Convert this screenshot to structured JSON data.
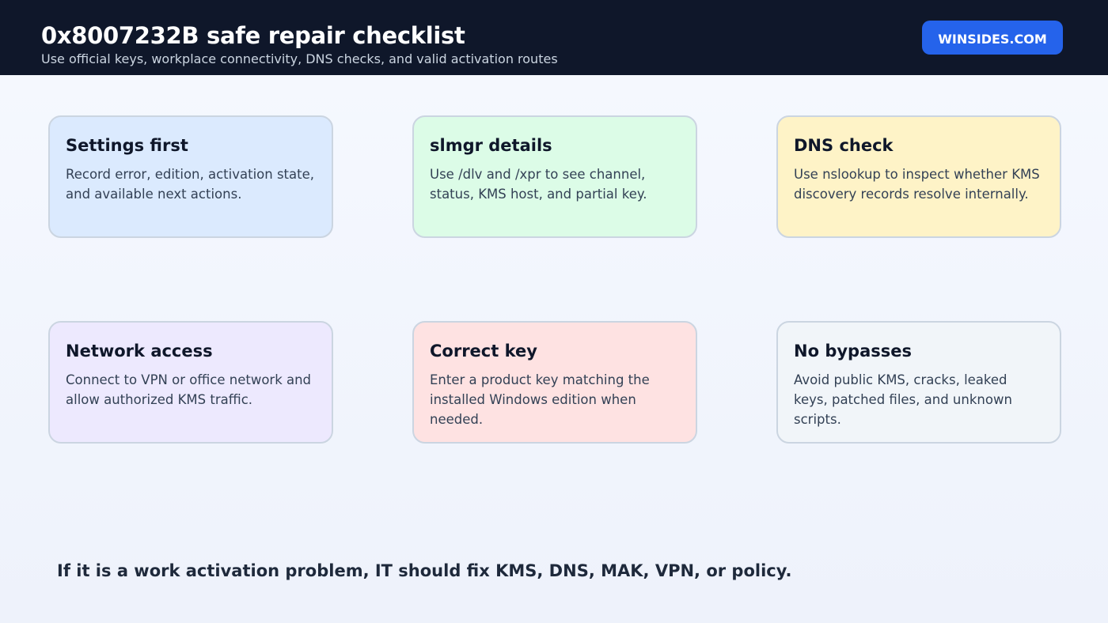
{
  "header": {
    "title": "0x8007232B safe repair checklist",
    "subtitle": "Use official keys, workplace connectivity, DNS checks, and valid activation routes",
    "brand": "WINSIDES.COM"
  },
  "cards": [
    {
      "title": "Settings first",
      "text": "Record error, edition, activation state, and available next actions.",
      "color": "#dbeafe"
    },
    {
      "title": "slmgr details",
      "text": "Use /dlv and /xpr to see channel, status, KMS host, and partial key.",
      "color": "#dcfce7"
    },
    {
      "title": "DNS check",
      "text": "Use nslookup to inspect whether KMS discovery records resolve internally.",
      "color": "#fef3c7"
    },
    {
      "title": "Network access",
      "text": "Connect to VPN or office network and allow authorized KMS traffic.",
      "color": "#ede9fe"
    },
    {
      "title": "Correct key",
      "text": "Enter a product key matching the installed Windows edition when needed.",
      "color": "#fee2e2"
    },
    {
      "title": "No bypasses",
      "text": "Avoid public KMS, cracks, leaked keys, patched files, and unknown scripts.",
      "color": "#f1f5f9"
    }
  ],
  "footer": {
    "note": "If it is a work activation problem, IT should fix KMS, DNS, MAK, VPN, or policy."
  },
  "colors": {
    "header_bg": "#0f172a",
    "brand_bg": "#2563eb",
    "card_border": "#cbd5e1"
  }
}
